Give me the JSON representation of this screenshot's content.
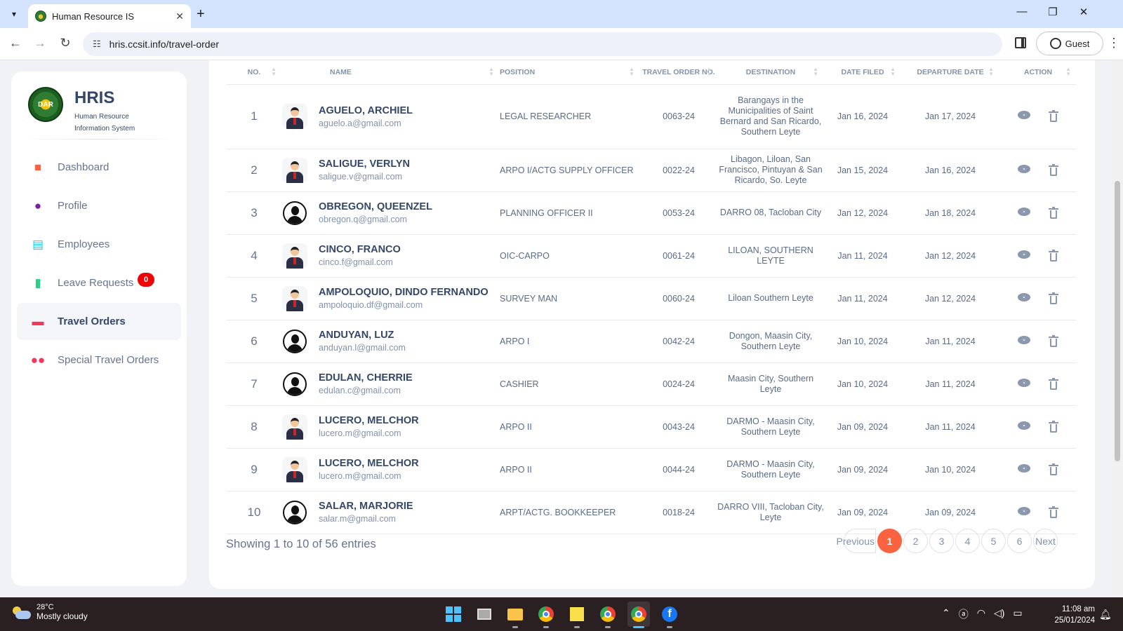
{
  "browser": {
    "tab_title": "Human Resource IS",
    "url": "hris.ccsit.info/travel-order",
    "profile_label": "Guest"
  },
  "sidebar": {
    "brand_name": "HRIS",
    "brand_sub_line1": "Human Resource",
    "brand_sub_line2": "Information System",
    "logo_text": "DAR",
    "items": [
      {
        "label": "Dashboard",
        "icon": "cube-icon",
        "color": "#fb6340"
      },
      {
        "label": "Profile",
        "icon": "user-icon",
        "color": "#7b1fa2"
      },
      {
        "label": "Employees",
        "icon": "id-card-icon",
        "color": "#11cdef"
      },
      {
        "label": "Leave Requests",
        "icon": "book-icon",
        "color": "#2dce89",
        "badge": "0"
      },
      {
        "label": "Travel Orders",
        "icon": "briefcase-icon",
        "color": "#f5365c",
        "active": true
      },
      {
        "label": "Special Travel Orders",
        "icon": "users-icon",
        "color": "#f5365c"
      }
    ]
  },
  "table": {
    "headers": [
      "No.",
      "Name",
      "Position",
      "Travel Order No.",
      "Destination",
      "Date Filed",
      "Departure Date",
      "Action"
    ],
    "rows": [
      {
        "no": "1",
        "name": "AGUELO, ARCHIEL",
        "email": "aguelo.a@gmail.com",
        "position": "LEGAL RESEARCHER",
        "to_no": "0063-24",
        "destination": "Barangays in the Municipalities of Saint Bernard and San Ricardo, Southern Leyte",
        "date_filed": "Jan 16, 2024",
        "departure": "Jan 17, 2024",
        "avatar": "suit"
      },
      {
        "no": "2",
        "name": "SALIGUE, VERLYN",
        "email": "saligue.v@gmail.com",
        "position": "ARPO I/ACTG SUPPLY OFFICER",
        "to_no": "0022-24",
        "destination": "Libagon, Liloan, San Francisco, Pintuyan & San Ricardo, So. Leyte",
        "date_filed": "Jan 15, 2024",
        "departure": "Jan 16, 2024",
        "avatar": "suit"
      },
      {
        "no": "3",
        "name": "OBREGON, QUEENZEL",
        "email": "obregon.q@gmail.com",
        "position": "PLANNING OFFICER II",
        "to_no": "0053-24",
        "destination": "DARRO 08, Tacloban City",
        "date_filed": "Jan 12, 2024",
        "departure": "Jan 18, 2024",
        "avatar": "silhouette"
      },
      {
        "no": "4",
        "name": "CINCO, FRANCO",
        "email": "cinco.f@gmail.com",
        "position": "OIC-CARPO",
        "to_no": "0061-24",
        "destination": "LILOAN, SOUTHERN LEYTE",
        "date_filed": "Jan 11, 2024",
        "departure": "Jan 12, 2024",
        "avatar": "suit"
      },
      {
        "no": "5",
        "name": "AMPOLOQUIO, DINDO FERNANDO",
        "email": "ampoloquio.df@gmail.com",
        "position": "SURVEY MAN",
        "to_no": "0060-24",
        "destination": "Liloan Southern Leyte",
        "date_filed": "Jan 11, 2024",
        "departure": "Jan 12, 2024",
        "avatar": "suit"
      },
      {
        "no": "6",
        "name": "ANDUYAN, LUZ",
        "email": "anduyan.l@gmail.com",
        "position": "ARPO I",
        "to_no": "0042-24",
        "destination": "Dongon, Maasin City, Southern Leyte",
        "date_filed": "Jan 10, 2024",
        "departure": "Jan 11, 2024",
        "avatar": "silhouette"
      },
      {
        "no": "7",
        "name": "EDULAN, CHERRIE",
        "email": "edulan.c@gmail.com",
        "position": "CASHIER",
        "to_no": "0024-24",
        "destination": "Maasin City, Southern Leyte",
        "date_filed": "Jan 10, 2024",
        "departure": "Jan 11, 2024",
        "avatar": "silhouette"
      },
      {
        "no": "8",
        "name": "LUCERO, MELCHOR",
        "email": "lucero.m@gmail.com",
        "position": "ARPO II",
        "to_no": "0043-24",
        "destination": "DARMO - Maasin City, Southern Leyte",
        "date_filed": "Jan 09, 2024",
        "departure": "Jan 11, 2024",
        "avatar": "suit"
      },
      {
        "no": "9",
        "name": "LUCERO, MELCHOR",
        "email": "lucero.m@gmail.com",
        "position": "ARPO II",
        "to_no": "0044-24",
        "destination": "DARMO - Maasin City, Southern Leyte",
        "date_filed": "Jan 09, 2024",
        "departure": "Jan 10, 2024",
        "avatar": "suit"
      },
      {
        "no": "10",
        "name": "SALAR, MARJORIE",
        "email": "salar.m@gmail.com",
        "position": "ARPT/ACTG. BOOKKEEPER",
        "to_no": "0018-24",
        "destination": "DARRO VIII, Tacloban City, Leyte",
        "date_filed": "Jan 09, 2024",
        "departure": "Jan 09, 2024",
        "avatar": "silhouette"
      }
    ]
  },
  "footer": {
    "showing": "Showing 1 to 10 of 56 entries",
    "prev_label": "Previous",
    "next_label": "Next",
    "pages": [
      "1",
      "2",
      "3",
      "4",
      "5",
      "6"
    ],
    "active_page": "1"
  },
  "taskbar": {
    "temp": "28°C",
    "weather": "Mostly cloudy",
    "time": "11:08 am",
    "date": "25/01/2024"
  }
}
